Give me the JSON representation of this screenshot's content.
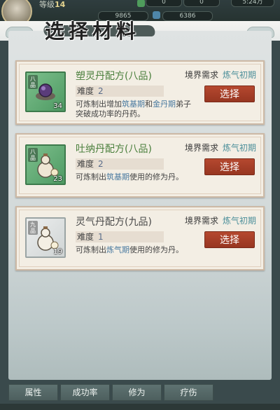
{
  "header": {
    "level_prefix": "等级",
    "level": "14",
    "stat_1": "0",
    "stat_2": "0",
    "stat_3": "5:24万",
    "stat_4": "9865",
    "stat_5": "6386"
  },
  "title": "选择材料",
  "recipes": [
    {
      "name": "塑灵丹配方(八品)",
      "grade": "八品",
      "count": "34",
      "req_label": "境界需求",
      "req_value": "炼气初期",
      "difficulty_label": "难度",
      "difficulty": "2",
      "desc_pre": "可炼制出增加",
      "desc_hl1": "筑基期",
      "desc_mid": "和",
      "desc_hl2": "金丹期",
      "desc_post": "弟子突破成功率的丹药。",
      "button": "选择"
    },
    {
      "name": "吐纳丹配方(八品)",
      "grade": "八品",
      "count": "23",
      "req_label": "境界需求",
      "req_value": "炼气初期",
      "difficulty_label": "难度",
      "difficulty": "2",
      "desc_pre": "可炼制出",
      "desc_hl1": "筑基期",
      "desc_post": "使用的修为丹。",
      "button": "选择"
    },
    {
      "name": "灵气丹配方(九品)",
      "grade": "九品",
      "count": "19",
      "req_label": "境界需求",
      "req_value": "炼气初期",
      "difficulty_label": "难度",
      "difficulty": "1",
      "desc_pre": "可炼制出",
      "desc_hl1": "炼气期",
      "desc_post": "使用的修为丹。",
      "button": "选择"
    }
  ],
  "tabs": [
    "属性",
    "成功率",
    "修为",
    "疗伤"
  ],
  "colors": {
    "choose_button": "#a63f27",
    "recipe_name_green": "#4a7f3c",
    "highlight": "#4a7aa0"
  }
}
